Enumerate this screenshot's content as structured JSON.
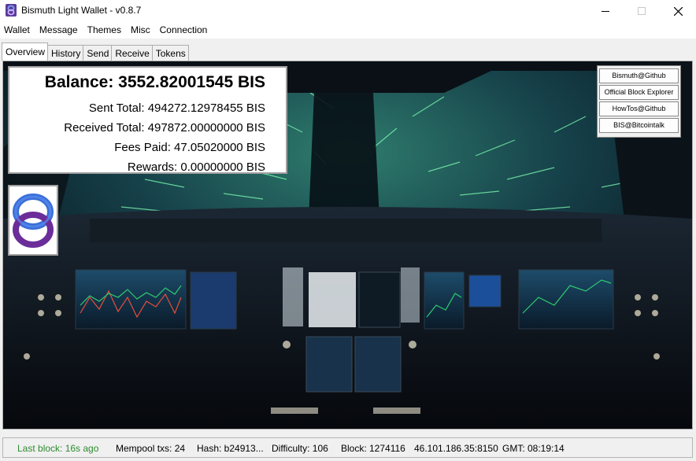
{
  "window": {
    "title": "Bismuth Light Wallet - v0.8.7",
    "icon": "bismuth-logo-icon"
  },
  "menu": {
    "items": [
      {
        "label": "Wallet"
      },
      {
        "label": "Message"
      },
      {
        "label": "Themes"
      },
      {
        "label": "Misc"
      },
      {
        "label": "Connection"
      }
    ]
  },
  "tabs": [
    {
      "label": "Overview",
      "active": true
    },
    {
      "label": "History"
    },
    {
      "label": "Send"
    },
    {
      "label": "Receive"
    },
    {
      "label": "Tokens"
    }
  ],
  "overview": {
    "balance": "Balance: 3552.82001545 BIS",
    "sent_total": "Sent Total: 494272.12978455 BIS",
    "received_total": "Received Total: 497872.00000000 BIS",
    "fees_paid": "Fees Paid: 47.05020000 BIS",
    "rewards": "Rewards: 0.00000000 BIS",
    "background": "cockpit-starfield-image"
  },
  "links": [
    {
      "label": "Bismuth@Github"
    },
    {
      "label": "Official Block Explorer"
    },
    {
      "label": "HowTos@Github"
    },
    {
      "label": "BIS@Bitcointalk"
    }
  ],
  "status": {
    "last_block": "Last block: 16s ago",
    "mempool": "Mempool txs: 24",
    "hash": "Hash: b24913...",
    "difficulty": "Difficulty: 106",
    "block": "Block: 1274116",
    "server": "46.101.186.35:8150",
    "gmt": "GMT: 08:19:14"
  },
  "colors": {
    "last_block": "#2e8b2e",
    "logo_purple": "#6b2d9a",
    "logo_blue": "#3a6fd8"
  }
}
